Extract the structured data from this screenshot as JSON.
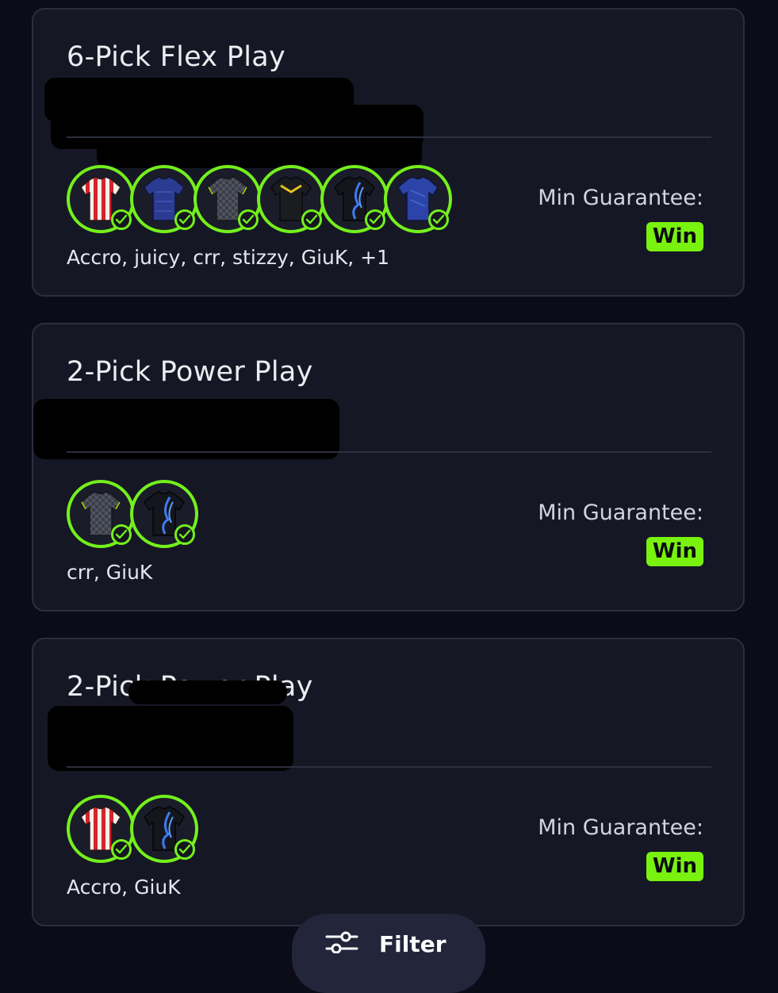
{
  "cards": [
    {
      "title": "6-Pick Flex Play",
      "names": "Accro, juicy, crr, stizzy, GiuK, +1",
      "min_label": "Min Guarantee:",
      "result": "Win",
      "avatars": [
        "red-white-striped-jersey-icon",
        "blue-jersey-icon",
        "gray-checkered-jersey-icon",
        "black-yellow-jersey-icon",
        "black-blue-flame-jersey-icon",
        "blue-jersey-icon"
      ]
    },
    {
      "title": "2-Pick Power Play",
      "names": "crr, GiuK",
      "min_label": "Min Guarantee:",
      "result": "Win",
      "avatars": [
        "gray-checkered-jersey-icon",
        "black-blue-flame-jersey-icon"
      ]
    },
    {
      "title": "2-Pick Power Play",
      "names": "Accro, GiuK",
      "min_label": "Min Guarantee:",
      "result": "Win",
      "avatars": [
        "red-white-striped-jersey-icon",
        "black-blue-flame-jersey-icon"
      ]
    }
  ],
  "filter": {
    "label": "Filter",
    "icon": "sliders-icon"
  },
  "colors": {
    "accent": "#78f20e",
    "background": "#0b0c18",
    "card": "#151725"
  }
}
